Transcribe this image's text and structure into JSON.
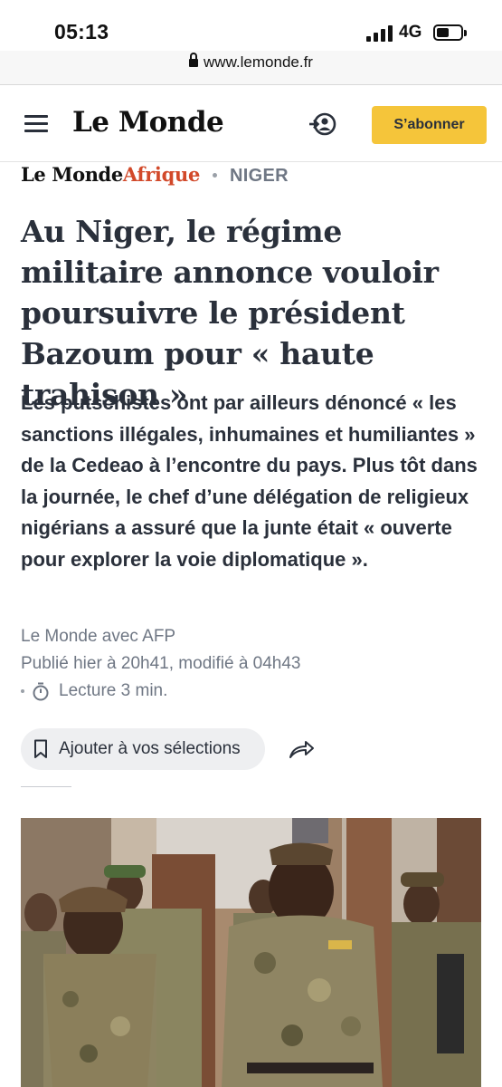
{
  "status_bar": {
    "time": "05:13",
    "network": "4G"
  },
  "browser": {
    "url": "www.lemonde.fr"
  },
  "header": {
    "logo": "Le Monde",
    "subscribe_label": "S’abonner"
  },
  "section": {
    "brand": "Le Monde",
    "brand_suffix": "Afrique",
    "rubric": "NIGER"
  },
  "article": {
    "title": "Au Niger, le régime militaire annonce vouloir poursuivre le président Bazoum pour « haute trahison »",
    "lede": "Les putschistes ont par ailleurs dénoncé « les sanctions illégales, inhumaines et humiliantes » de la Cedeao à l’encontre du pays. Plus tôt dans la journée, le chef d’une délégation de religieux nigérians a assuré que la junte était « ouverte pour explorer la voie diplomatique ».",
    "author": "Le Monde avec AFP",
    "published": "Publié hier à 20h41, modifié à 04h43",
    "reading_time": "Lecture 3 min."
  },
  "actions": {
    "save_label": "Ajouter à vos sélections"
  },
  "icons": {
    "menu": "hamburger-menu-icon",
    "account": "user-account-icon",
    "timer": "stopwatch-icon",
    "bookmark": "bookmark-icon",
    "share": "share-arrow-icon",
    "lock": "lock-icon"
  },
  "colors": {
    "subscribe": "#f5c53a",
    "afrique": "#d2492a",
    "text": "#2a303b",
    "meta": "#6f7784"
  }
}
